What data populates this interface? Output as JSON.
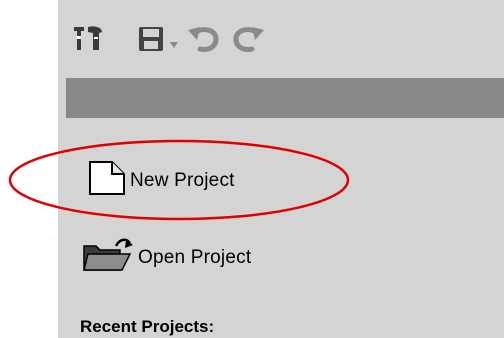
{
  "toolbar": {
    "icons": [
      "tools-icon",
      "save-icon",
      "dropdown-arrow-icon",
      "undo-icon",
      "redo-icon"
    ]
  },
  "actions": {
    "new_project": "New Project",
    "open_project": "Open Project"
  },
  "recent": {
    "title": "Recent Projects:"
  },
  "colors": {
    "panel": "#d4d4d4",
    "header_bar": "#888888",
    "highlight": "#e00000"
  }
}
